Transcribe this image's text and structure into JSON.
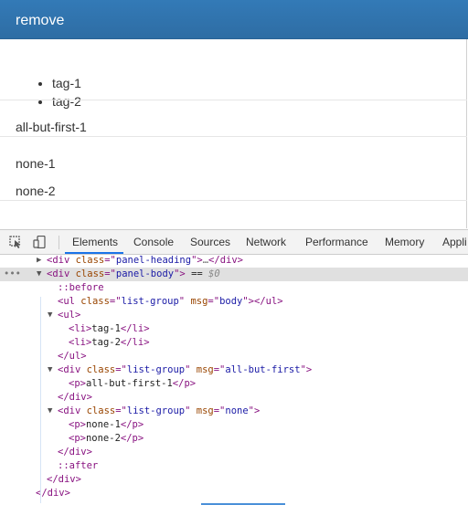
{
  "panel": {
    "title": "remove",
    "tags": [
      "tag-1",
      "tag-2"
    ],
    "all_but_first": "all-but-first-1",
    "none_items": [
      "none-1",
      "none-2"
    ]
  },
  "devtools": {
    "tabs": [
      "Elements",
      "Console",
      "Sources",
      "Network",
      "Performance",
      "Memory",
      "Appli"
    ],
    "active_tab": "Elements",
    "dots": "•••",
    "lines": {
      "l0": {
        "tag_open": "<div ",
        "attr": "class",
        "eq": "=\"",
        "val": "panel-heading",
        "close": "\">",
        "ell": "…",
        "end": "</div>"
      },
      "l1": {
        "tag_open": "<div ",
        "attr": "class",
        "eq": "=\"",
        "val": "panel-body",
        "close": "\">",
        "eqsign": " == ",
        "dollar": "$0"
      },
      "l2": {
        "pseudo": "::before"
      },
      "l3": {
        "tag_open": "<ul ",
        "attr": "class",
        "eq": "=\"",
        "val": "list-group",
        "q": "\" ",
        "attr2": "msg",
        "eq2": "=\"",
        "val2": "body",
        "close": "\">",
        "end": "</ul>"
      },
      "l4": {
        "tag": "<ul>"
      },
      "l5": {
        "open": "<li>",
        "text": "tag-1",
        "close": "</li>"
      },
      "l6": {
        "open": "<li>",
        "text": "tag-2",
        "close": "</li>"
      },
      "l7": {
        "tag": "</ul>"
      },
      "l8": {
        "tag_open": "<div ",
        "attr": "class",
        "eq": "=\"",
        "val": "list-group",
        "q": "\" ",
        "attr2": "msg",
        "eq2": "=\"",
        "val2": "all-but-first",
        "close": "\">"
      },
      "l9": {
        "open": "<p>",
        "text": "all-but-first-1",
        "close": "</p>"
      },
      "l10": {
        "tag": "</div>"
      },
      "l11": {
        "tag_open": "<div ",
        "attr": "class",
        "eq": "=\"",
        "val": "list-group",
        "q": "\" ",
        "attr2": "msg",
        "eq2": "=\"",
        "val2": "none",
        "close": "\">"
      },
      "l12": {
        "open": "<p>",
        "text": "none-1",
        "close": "</p>"
      },
      "l13": {
        "open": "<p>",
        "text": "none-2",
        "close": "</p>"
      },
      "l14": {
        "tag": "</div>"
      },
      "l15": {
        "pseudo": "::after"
      },
      "l16": {
        "tag": "</div>"
      },
      "l17": {
        "tag": "</div>"
      }
    }
  },
  "colors": {
    "panel_heading": "#337ab7",
    "tab_underline": "#1a73e8",
    "selected_row": "#e0e0e0",
    "tag": "#881280",
    "attr_name": "#994500",
    "attr_value": "#1a1aa6"
  },
  "icons": [
    "inspect-element-icon",
    "device-toolbar-icon",
    "expand-triangle-icon",
    "collapse-triangle-icon"
  ]
}
